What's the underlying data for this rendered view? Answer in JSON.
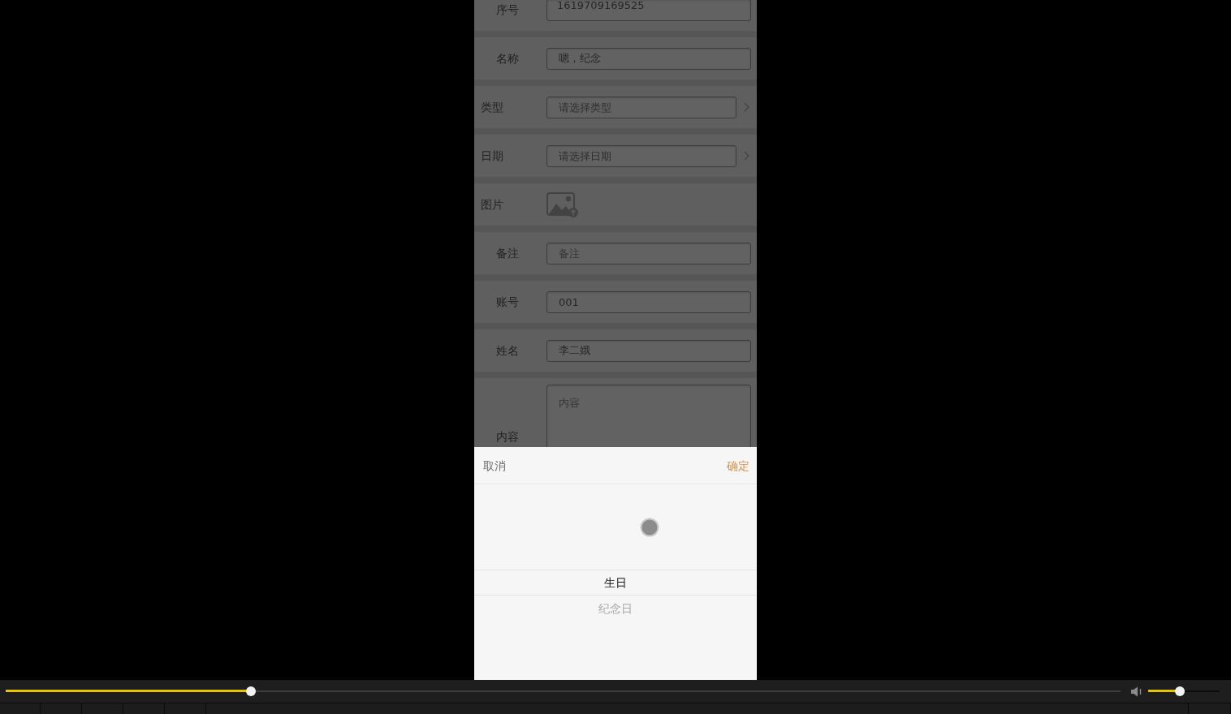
{
  "form": {
    "rows": [
      {
        "kind": "readonly",
        "label": "序号",
        "value": "1619709169525"
      },
      {
        "kind": "text",
        "label": "名称",
        "value": "嗯，纪念"
      },
      {
        "kind": "select",
        "label": "类型",
        "placeholder": "请选择类型"
      },
      {
        "kind": "select",
        "label": "日期",
        "placeholder": "请选择日期"
      },
      {
        "kind": "image",
        "label": "图片"
      },
      {
        "kind": "text",
        "label": "备注",
        "placeholder": "备注"
      },
      {
        "kind": "text",
        "label": "账号",
        "value": "001"
      },
      {
        "kind": "text",
        "label": "姓名",
        "value": "李二娥"
      },
      {
        "kind": "textarea",
        "label": "内容",
        "placeholder": "内容"
      }
    ]
  },
  "picker": {
    "open": true,
    "cancel": "取消",
    "confirm": "确定",
    "loading": true,
    "options": [
      {
        "label": "生日",
        "selected": true
      },
      {
        "label": "纪念日",
        "selected": false
      }
    ]
  },
  "player": {
    "seek": {
      "level": 0.22
    },
    "volume": {
      "level": 0.44
    }
  }
}
